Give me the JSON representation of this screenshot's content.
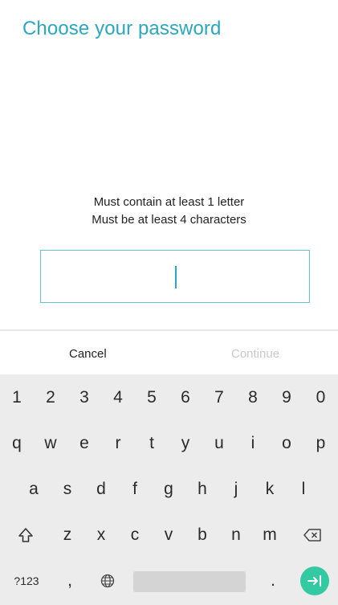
{
  "header": {
    "title": "Choose your password"
  },
  "rules": {
    "line1": "Must contain at least 1 letter",
    "line2": "Must be at least 4 characters"
  },
  "password_field": {
    "value": ""
  },
  "actions": {
    "cancel": "Cancel",
    "continue": "Continue"
  },
  "keyboard": {
    "row_numbers": [
      "1",
      "2",
      "3",
      "4",
      "5",
      "6",
      "7",
      "8",
      "9",
      "0"
    ],
    "row1": [
      "q",
      "w",
      "e",
      "r",
      "t",
      "y",
      "u",
      "i",
      "o",
      "p"
    ],
    "row2": [
      "a",
      "s",
      "d",
      "f",
      "g",
      "h",
      "j",
      "k",
      "l"
    ],
    "row3": [
      "z",
      "x",
      "c",
      "v",
      "b",
      "n",
      "m"
    ],
    "symbols_label": "?123",
    "comma": ",",
    "period": ".",
    "icons": {
      "shift": "shift-icon",
      "backspace": "backspace-icon",
      "globe": "globe-icon",
      "enter": "next-field-icon"
    },
    "colors": {
      "enter": "#33c9a3",
      "accent": "#2aa7c1"
    }
  }
}
